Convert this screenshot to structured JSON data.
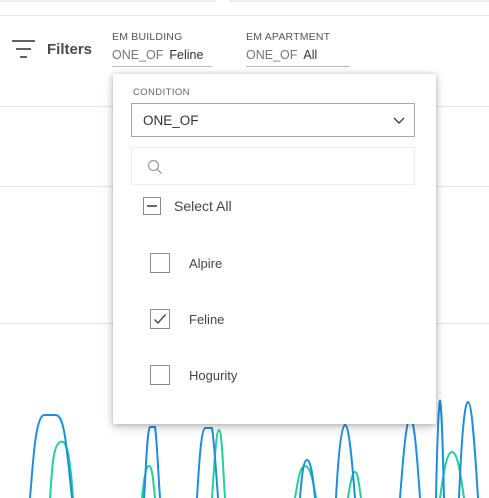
{
  "filters_button": {
    "label": "Filters",
    "icon": "filter-icon"
  },
  "filter_groups": [
    {
      "title": "EM BUILDING",
      "operator": "ONE_OF",
      "value": "Feline"
    },
    {
      "title": "EM APARTMENT",
      "operator": "ONE_OF",
      "value": "All"
    }
  ],
  "dropdown": {
    "condition_label": "CONDITION",
    "condition_value": "ONE_OF",
    "search_placeholder": "",
    "select_all_label": "Select All",
    "select_all_state": "indeterminate",
    "options": [
      {
        "label": "Alpire",
        "checked": false
      },
      {
        "label": "Feline",
        "checked": true
      },
      {
        "label": "Hogurity",
        "checked": false
      }
    ]
  },
  "colors": {
    "series_blue": "#1f8fdc",
    "series_green": "#1fd19a",
    "checkbox_border": "#8a8a8a",
    "divider": "#e6e6e6"
  }
}
